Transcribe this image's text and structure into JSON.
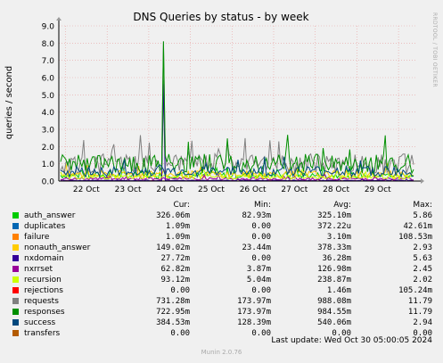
{
  "chart_data": {
    "type": "line",
    "title": "DNS Queries by status - by week",
    "ylabel": "queries / second",
    "xlabel": "",
    "ylim": [
      0,
      9
    ],
    "yticks": [
      "0.0",
      "1.0",
      "2.0",
      "3.0",
      "4.0",
      "5.0",
      "6.0",
      "7.0",
      "8.0",
      "9.0"
    ],
    "categories": [
      "22 Oct",
      "23 Oct",
      "24 Oct",
      "25 Oct",
      "26 Oct",
      "27 Oct",
      "28 Oct",
      "29 Oct"
    ],
    "grid": true,
    "series": [
      {
        "name": "auth_answer",
        "color": "#00cc00",
        "cur": "326.06m",
        "min": "82.93m",
        "avg": "325.10m",
        "max": "5.86"
      },
      {
        "name": "duplicates",
        "color": "#0066b3",
        "cur": "1.09m",
        "min": "0.00",
        "avg": "372.22u",
        "max": "42.61m"
      },
      {
        "name": "failure",
        "color": "#ff8000",
        "cur": "1.09m",
        "min": "0.00",
        "avg": "3.10m",
        "max": "108.53m"
      },
      {
        "name": "nonauth_answer",
        "color": "#ffcc00",
        "cur": "149.02m",
        "min": "23.44m",
        "avg": "378.33m",
        "max": "2.93"
      },
      {
        "name": "nxdomain",
        "color": "#330099",
        "cur": "27.72m",
        "min": "0.00",
        "avg": "36.28m",
        "max": "5.63"
      },
      {
        "name": "nxrrset",
        "color": "#990099",
        "cur": "62.82m",
        "min": "3.87m",
        "avg": "126.98m",
        "max": "2.45"
      },
      {
        "name": "recursion",
        "color": "#ccff00",
        "cur": "93.12m",
        "min": "5.04m",
        "avg": "238.87m",
        "max": "2.02"
      },
      {
        "name": "rejections",
        "color": "#ff0000",
        "cur": "0.00",
        "min": "0.00",
        "avg": "1.46m",
        "max": "105.24m"
      },
      {
        "name": "requests",
        "color": "#808080",
        "cur": "731.28m",
        "min": "173.97m",
        "avg": "988.08m",
        "max": "11.79"
      },
      {
        "name": "responses",
        "color": "#008f00",
        "cur": "722.95m",
        "min": "173.97m",
        "avg": "984.55m",
        "max": "11.79"
      },
      {
        "name": "success",
        "color": "#00487d",
        "cur": "384.53m",
        "min": "128.39m",
        "avg": "540.06m",
        "max": "2.94"
      },
      {
        "name": "transfers",
        "color": "#b35a00",
        "cur": "0.00",
        "min": "0.00",
        "avg": "0.00",
        "max": "0.00"
      }
    ]
  },
  "legend_headers": {
    "cur": "Cur:",
    "min": "Min:",
    "avg": "Avg:",
    "max": "Max:"
  },
  "last_update": "Last update: Wed Oct 30 05:00:05 2024",
  "version": "Munin 2.0.76",
  "side_label": "RRDTOOL / TOBI OETIKER"
}
